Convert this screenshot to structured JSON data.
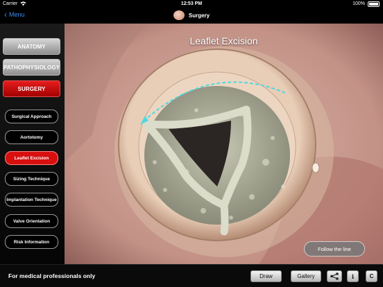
{
  "status": {
    "carrier": "Carrier",
    "time": "12:53 PM",
    "battery": "100%"
  },
  "nav": {
    "back_label": "Menu",
    "title": "Surgery"
  },
  "sidebar": {
    "categories": [
      {
        "label": "ANATOMY",
        "state": "inactive"
      },
      {
        "label": "PATHOPHYSIOLOGY",
        "state": "inactive"
      },
      {
        "label": "SURGERY",
        "state": "active"
      }
    ],
    "steps": [
      {
        "label": "Surgical Approach",
        "active": false
      },
      {
        "label": "Aortotomy",
        "active": false
      },
      {
        "label": "Leaflet Excision",
        "active": true
      },
      {
        "label": "Sizing Technique",
        "active": false
      },
      {
        "label": "Implantation Technique",
        "active": false
      },
      {
        "label": "Valve Orientation",
        "active": false
      },
      {
        "label": "Risk Information",
        "active": false
      }
    ]
  },
  "main": {
    "title": "Leaflet Excision",
    "follow_button": "Follow the line"
  },
  "footer": {
    "note": "For medical professionals only",
    "draw": "Draw",
    "gallery": "Gallery",
    "info": "i",
    "copyright": "C"
  },
  "colors": {
    "accent_red": "#d80f0f",
    "link_blue": "#3a8df5",
    "trace_cyan": "#4fd8e0"
  },
  "icons": [
    "wifi-icon",
    "battery-icon",
    "back-chevron-icon",
    "heart-icon",
    "share-icon"
  ]
}
